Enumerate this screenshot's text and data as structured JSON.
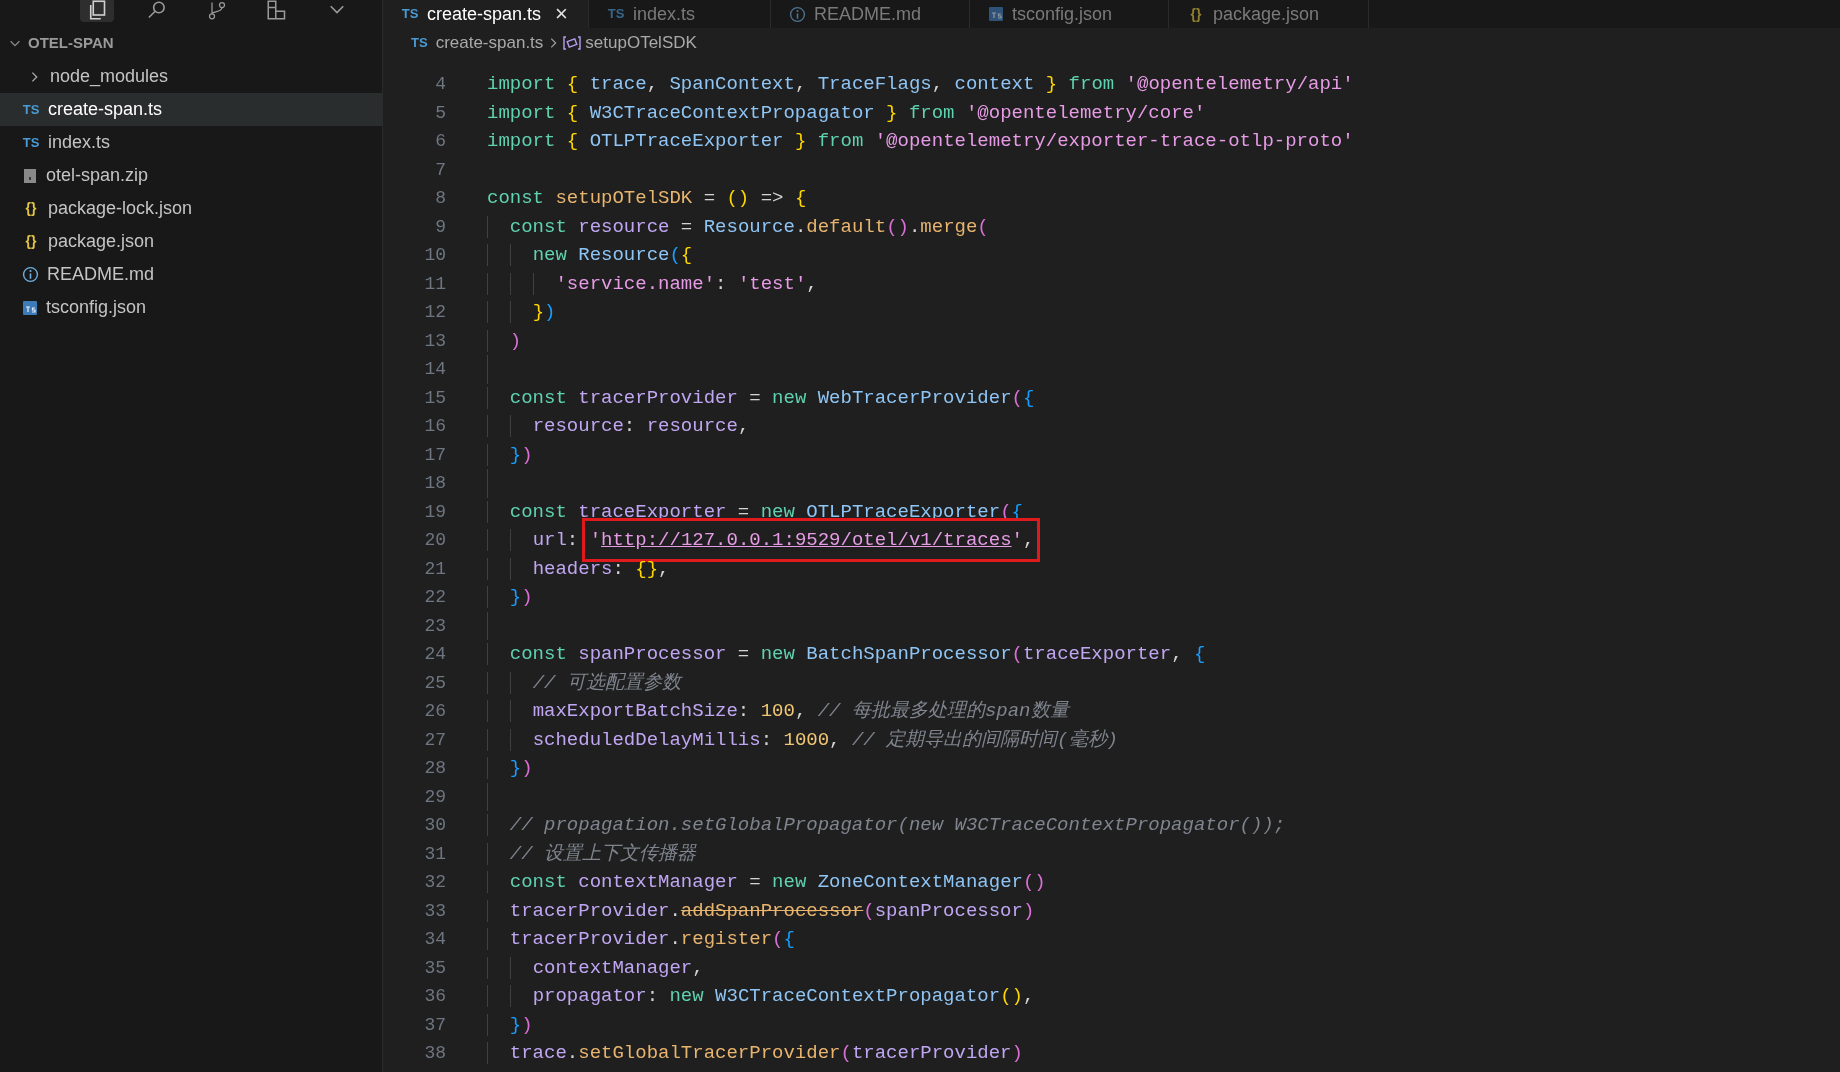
{
  "activity_icons": [
    {
      "kind": "files",
      "selected": true
    },
    {
      "kind": "search",
      "selected": false
    },
    {
      "kind": "branch",
      "selected": false
    },
    {
      "kind": "extensions",
      "selected": false
    },
    {
      "kind": "more",
      "selected": false
    }
  ],
  "explorer": {
    "title": "OTEL-SPAN",
    "items": [
      {
        "label": "node_modules",
        "kind": "folder",
        "selected": false
      },
      {
        "label": "create-span.ts",
        "kind": "ts",
        "glyph": "TS",
        "selected": true
      },
      {
        "label": "index.ts",
        "kind": "ts",
        "glyph": "TS",
        "selected": false
      },
      {
        "label": "otel-span.zip",
        "kind": "zip",
        "selected": false
      },
      {
        "label": "package-lock.json",
        "kind": "json",
        "glyph": "{}",
        "selected": false
      },
      {
        "label": "package.json",
        "kind": "json",
        "glyph": "{}",
        "selected": false
      },
      {
        "label": "README.md",
        "kind": "info",
        "selected": false
      },
      {
        "label": "tsconfig.json",
        "kind": "tsconfig",
        "selected": false
      }
    ]
  },
  "tabs": [
    {
      "label": "create-span.ts",
      "kind": "ts",
      "glyph": "TS",
      "selected": true,
      "close": "×"
    },
    {
      "label": "index.ts",
      "kind": "ts",
      "glyph": "TS",
      "selected": false
    },
    {
      "label": "README.md",
      "kind": "info",
      "selected": false
    },
    {
      "label": "tsconfig.json",
      "kind": "tsconfig",
      "selected": false
    },
    {
      "label": "package.json",
      "kind": "json",
      "glyph": "{}",
      "selected": false
    }
  ],
  "breadcrumb": {
    "glyph": "TS",
    "file": "create-span.ts",
    "symbol": "setupOTelSDK"
  },
  "code": [
    {
      "n": "4",
      "tokens": [
        {
          "kind": "kw",
          "text": "import "
        },
        {
          "kind": "b1",
          "text": "{ "
        },
        {
          "kind": "cls",
          "text": "trace"
        },
        {
          "kind": "p",
          "text": ", "
        },
        {
          "kind": "cls",
          "text": "SpanContext"
        },
        {
          "kind": "p",
          "text": ", "
        },
        {
          "kind": "cls",
          "text": "TraceFlags"
        },
        {
          "kind": "p",
          "text": ", "
        },
        {
          "kind": "cls",
          "text": "context"
        },
        {
          "kind": "b1",
          "text": " }"
        },
        {
          "kind": "kw",
          "text": " from "
        },
        {
          "kind": "str",
          "text": "'@opentelemetry/api'"
        }
      ]
    },
    {
      "n": "5",
      "tokens": [
        {
          "kind": "kw",
          "text": "import "
        },
        {
          "kind": "b1",
          "text": "{ "
        },
        {
          "kind": "cls",
          "text": "W3CTraceContextPropagator"
        },
        {
          "kind": "b1",
          "text": " }"
        },
        {
          "kind": "kw",
          "text": " from "
        },
        {
          "kind": "str",
          "text": "'@opentelemetry/core'"
        }
      ]
    },
    {
      "n": "6",
      "tokens": [
        {
          "kind": "kw",
          "text": "import "
        },
        {
          "kind": "b1",
          "text": "{ "
        },
        {
          "kind": "cls",
          "text": "OTLPTraceExporter"
        },
        {
          "kind": "b1",
          "text": " }"
        },
        {
          "kind": "kw",
          "text": " from "
        },
        {
          "kind": "str",
          "text": "'@opentelemetry/exporter-trace-otlp-proto'"
        }
      ]
    },
    {
      "n": "7"
    },
    {
      "n": "8",
      "tokens": [
        {
          "kind": "kw",
          "text": "const "
        },
        {
          "kind": "fn",
          "text": "setupOTelSDK"
        },
        {
          "kind": "p",
          "text": " = "
        },
        {
          "kind": "b1",
          "text": "()"
        },
        {
          "kind": "p",
          "text": " => "
        },
        {
          "kind": "b1",
          "text": "{"
        }
      ]
    },
    {
      "n": "9",
      "tokens": [
        {
          "kind": "kw",
          "text": "  const "
        },
        {
          "kind": "var",
          "text": "resource"
        },
        {
          "kind": "p",
          "text": " = "
        },
        {
          "kind": "cls",
          "text": "Resource"
        },
        {
          "kind": "p",
          "text": "."
        },
        {
          "kind": "fn",
          "text": "default"
        },
        {
          "kind": "b2",
          "text": "()"
        },
        {
          "kind": "p",
          "text": "."
        },
        {
          "kind": "fn",
          "text": "merge"
        },
        {
          "kind": "b2",
          "text": "("
        }
      ]
    },
    {
      "n": "10",
      "tokens": [
        {
          "kind": "kw",
          "text": "    new "
        },
        {
          "kind": "cls",
          "text": "Resource"
        },
        {
          "kind": "b3",
          "text": "("
        },
        {
          "kind": "b1",
          "text": "{"
        }
      ]
    },
    {
      "n": "11",
      "tokens": [
        {
          "kind": "str",
          "text": "      'service.name'"
        },
        {
          "kind": "p",
          "text": ": "
        },
        {
          "kind": "str",
          "text": "'test'"
        },
        {
          "kind": "p",
          "text": ","
        }
      ]
    },
    {
      "n": "12",
      "tokens": [
        {
          "kind": "b1",
          "text": "    }"
        },
        {
          "kind": "b3",
          "text": ")"
        }
      ]
    },
    {
      "n": "13",
      "tokens": [
        {
          "kind": "b2",
          "text": "  )"
        }
      ]
    },
    {
      "n": "14"
    },
    {
      "n": "15",
      "tokens": [
        {
          "kind": "kw",
          "text": "  const "
        },
        {
          "kind": "var",
          "text": "tracerProvider"
        },
        {
          "kind": "p",
          "text": " = "
        },
        {
          "kind": "kw",
          "text": "new "
        },
        {
          "kind": "cls",
          "text": "WebTracerProvider"
        },
        {
          "kind": "b2",
          "text": "("
        },
        {
          "kind": "b3",
          "text": "{"
        }
      ]
    },
    {
      "n": "16",
      "tokens": [
        {
          "kind": "var",
          "text": "    resource"
        },
        {
          "kind": "p",
          "text": ": "
        },
        {
          "kind": "var",
          "text": "resource"
        },
        {
          "kind": "p",
          "text": ","
        }
      ]
    },
    {
      "n": "17",
      "tokens": [
        {
          "kind": "b3",
          "text": "  }"
        },
        {
          "kind": "b2",
          "text": ")"
        }
      ]
    },
    {
      "n": "18"
    },
    {
      "n": "19",
      "tokens": [
        {
          "kind": "kw",
          "text": "  const "
        },
        {
          "kind": "var",
          "text": "traceExporter"
        },
        {
          "kind": "p",
          "text": " = "
        },
        {
          "kind": "kw",
          "text": "new "
        },
        {
          "kind": "cls",
          "text": "OTLPTraceExporter"
        },
        {
          "kind": "b2",
          "text": "("
        },
        {
          "kind": "b3",
          "text": "{"
        }
      ]
    },
    {
      "n": "20",
      "highlighted": true,
      "tokens": [
        {
          "kind": "var",
          "text": "    url"
        },
        {
          "kind": "p",
          "text": ": "
        },
        {
          "kind": "str",
          "text": "'"
        },
        {
          "kind": "link",
          "text": "http://127.0.0.1:9529/otel/v1/traces"
        },
        {
          "kind": "str",
          "text": "'"
        },
        {
          "kind": "p",
          "text": ","
        }
      ]
    },
    {
      "n": "21",
      "tokens": [
        {
          "kind": "var",
          "text": "    headers"
        },
        {
          "kind": "p",
          "text": ": "
        },
        {
          "kind": "b1",
          "text": "{}"
        },
        {
          "kind": "p",
          "text": ","
        }
      ]
    },
    {
      "n": "22",
      "tokens": [
        {
          "kind": "b3",
          "text": "  }"
        },
        {
          "kind": "b2",
          "text": ")"
        }
      ]
    },
    {
      "n": "23"
    },
    {
      "n": "24",
      "tokens": [
        {
          "kind": "kw",
          "text": "  const "
        },
        {
          "kind": "var",
          "text": "spanProcessor"
        },
        {
          "kind": "p",
          "text": " = "
        },
        {
          "kind": "kw",
          "text": "new "
        },
        {
          "kind": "cls",
          "text": "BatchSpanProcessor"
        },
        {
          "kind": "b2",
          "text": "("
        },
        {
          "kind": "var",
          "text": "traceExporter"
        },
        {
          "kind": "p",
          "text": ", "
        },
        {
          "kind": "b3",
          "text": "{"
        }
      ]
    },
    {
      "n": "25",
      "tokens": [
        {
          "kind": "cm",
          "text": "    // 可选配置参数"
        }
      ]
    },
    {
      "n": "26",
      "tokens": [
        {
          "kind": "var",
          "text": "    maxExportBatchSize"
        },
        {
          "kind": "p",
          "text": ": "
        },
        {
          "kind": "num",
          "text": "100"
        },
        {
          "kind": "p",
          "text": ", "
        },
        {
          "kind": "cm",
          "text": "// 每批最多处理的span数量"
        }
      ]
    },
    {
      "n": "27",
      "tokens": [
        {
          "kind": "var",
          "text": "    scheduledDelayMillis"
        },
        {
          "kind": "p",
          "text": ": "
        },
        {
          "kind": "num",
          "text": "1000"
        },
        {
          "kind": "p",
          "text": ", "
        },
        {
          "kind": "cm",
          "text": "// 定期导出的间隔时间(毫秒)"
        }
      ]
    },
    {
      "n": "28",
      "tokens": [
        {
          "kind": "b3",
          "text": "  }"
        },
        {
          "kind": "b2",
          "text": ")"
        }
      ]
    },
    {
      "n": "29"
    },
    {
      "n": "30",
      "tokens": [
        {
          "kind": "cm",
          "text": "  // propagation.setGlobalPropagator(new W3CTraceContextPropagator());"
        }
      ]
    },
    {
      "n": "31",
      "tokens": [
        {
          "kind": "cm",
          "text": "  // 设置上下文传播器"
        }
      ]
    },
    {
      "n": "32",
      "tokens": [
        {
          "kind": "kw",
          "text": "  const "
        },
        {
          "kind": "var",
          "text": "contextManager"
        },
        {
          "kind": "p",
          "text": " = "
        },
        {
          "kind": "kw",
          "text": "new "
        },
        {
          "kind": "cls",
          "text": "ZoneContextManager"
        },
        {
          "kind": "b2",
          "text": "()"
        }
      ]
    },
    {
      "n": "33",
      "tokens": [
        {
          "kind": "var",
          "text": "  tracerProvider"
        },
        {
          "kind": "p",
          "text": "."
        },
        {
          "kind": "dep",
          "text": "addSpanProcessor"
        },
        {
          "kind": "b2",
          "text": "("
        },
        {
          "kind": "var",
          "text": "spanProcessor"
        },
        {
          "kind": "b2",
          "text": ")"
        }
      ]
    },
    {
      "n": "34",
      "tokens": [
        {
          "kind": "var",
          "text": "  tracerProvider"
        },
        {
          "kind": "p",
          "text": "."
        },
        {
          "kind": "fn",
          "text": "register"
        },
        {
          "kind": "b2",
          "text": "("
        },
        {
          "kind": "b3",
          "text": "{"
        }
      ]
    },
    {
      "n": "35",
      "tokens": [
        {
          "kind": "var",
          "text": "    contextManager"
        },
        {
          "kind": "p",
          "text": ","
        }
      ]
    },
    {
      "n": "36",
      "tokens": [
        {
          "kind": "var",
          "text": "    propagator"
        },
        {
          "kind": "p",
          "text": ": "
        },
        {
          "kind": "kw",
          "text": "new "
        },
        {
          "kind": "cls",
          "text": "W3CTraceContextPropagator"
        },
        {
          "kind": "b1",
          "text": "()"
        },
        {
          "kind": "p",
          "text": ","
        }
      ]
    },
    {
      "n": "37",
      "tokens": [
        {
          "kind": "b3",
          "text": "  }"
        },
        {
          "kind": "b2",
          "text": ")"
        }
      ]
    },
    {
      "n": "38",
      "tokens": [
        {
          "kind": "var",
          "text": "  trace"
        },
        {
          "kind": "p",
          "text": "."
        },
        {
          "kind": "fn",
          "text": "setGlobalTracerProvider"
        },
        {
          "kind": "b2",
          "text": "("
        },
        {
          "kind": "var",
          "text": "tracerProvider"
        },
        {
          "kind": "b2",
          "text": ")"
        }
      ]
    }
  ]
}
